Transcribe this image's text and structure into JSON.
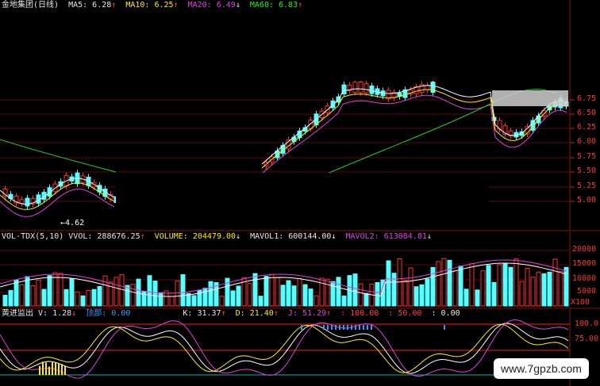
{
  "price_panel": {
    "title": "金地集团(日线)",
    "indicators": [
      {
        "label": "MA5: 6.28",
        "arrow": "↑",
        "color": "white"
      },
      {
        "label": "MA10: 6.25",
        "arrow": "↑",
        "color": "yellow"
      },
      {
        "label": "MA20: 6.49",
        "arrow": "↓",
        "color": "magenta"
      },
      {
        "label": "MA60: 6.83",
        "arrow": "↑",
        "color": "green"
      }
    ],
    "y_ticks": [
      "6.75",
      "6.50",
      "6.25",
      "6.00",
      "5.75",
      "5.50",
      "5.25",
      "5.00"
    ],
    "low_marker": "4.62"
  },
  "volume_panel": {
    "indicators": [
      {
        "label": "VOL-TDX(5,10) VVOL: 288676.25",
        "arrow": "↑",
        "color": "white"
      },
      {
        "label": "VOLUME: 204479.00",
        "arrow": "↓",
        "color": "yellow"
      },
      {
        "label": "MAVOL1: 600144.00",
        "arrow": "↓",
        "color": "white"
      },
      {
        "label": "MAVOL2: 613084.81",
        "arrow": "↓",
        "color": "magenta"
      }
    ],
    "y_ticks": [
      "20000",
      "15000",
      "10000",
      "5000",
      "X100"
    ]
  },
  "indicator_panel": {
    "indicators": [
      {
        "label": "黄进监出 V: 1.28",
        "arrow": "↓",
        "color": "white"
      },
      {
        "label": "顶部: 0.00",
        "arrow": "",
        "color": "blue"
      },
      {
        "label": "K: 31.37",
        "arrow": "↑",
        "color": "white"
      },
      {
        "label": "D: 21.40",
        "arrow": "↑",
        "color": "yellow"
      },
      {
        "label": "J: 51.29",
        "arrow": "↑",
        "color": "magenta"
      },
      {
        "label": ": 100.00",
        "arrow": "",
        "color": "red"
      },
      {
        "label": ": 50.00",
        "arrow": "",
        "color": "red"
      },
      {
        "label": ": 0.00",
        "arrow": "",
        "color": "white"
      }
    ],
    "y_ticks": [
      "100.0",
      "75.00"
    ]
  },
  "watermark": "www.7gpzb.com"
}
